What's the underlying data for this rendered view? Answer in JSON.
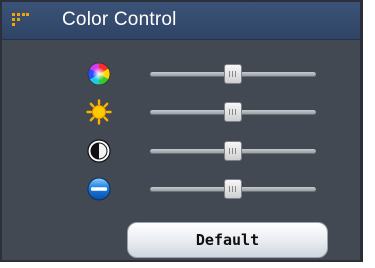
{
  "window": {
    "title": "Color Control",
    "grip_icon": "grip-dots-icon",
    "accent": "#f2a400"
  },
  "sliders": [
    {
      "name": "hue",
      "icon": "color-wheel-icon",
      "value": 0.5
    },
    {
      "name": "brightness",
      "icon": "sun-icon",
      "value": 0.5
    },
    {
      "name": "contrast",
      "icon": "contrast-icon",
      "value": 0.5
    },
    {
      "name": "saturation",
      "icon": "saturation-icon",
      "value": 0.5
    }
  ],
  "buttons": {
    "default_label": "Default"
  }
}
